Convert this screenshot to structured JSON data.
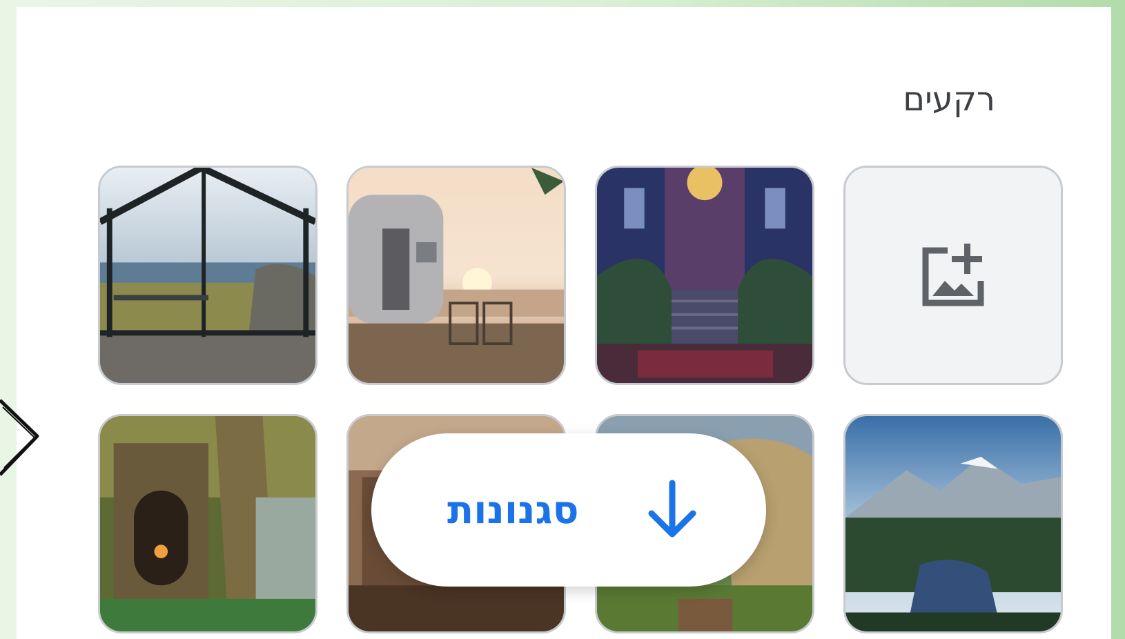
{
  "section": {
    "title": "רקעים"
  },
  "upload_tile": {
    "icon": "add-photo-icon"
  },
  "backgrounds": [
    {
      "name": "glass-cabin-landscape"
    },
    {
      "name": "airstream-trailer-sunset"
    },
    {
      "name": "grand-staircase-hall"
    },
    {
      "name": "ruined-temple-forest"
    },
    {
      "name": "rustic-interior"
    },
    {
      "name": "mossy-rock-garden"
    },
    {
      "name": "mountain-lake-forest"
    }
  ],
  "styles_button": {
    "label": "סגנונות",
    "icon": "arrow-down-icon"
  },
  "colors": {
    "accent": "#1a73e8",
    "title": "#3c4043",
    "tile_border": "#c7cacf",
    "upload_bg": "#f1f3f4"
  }
}
